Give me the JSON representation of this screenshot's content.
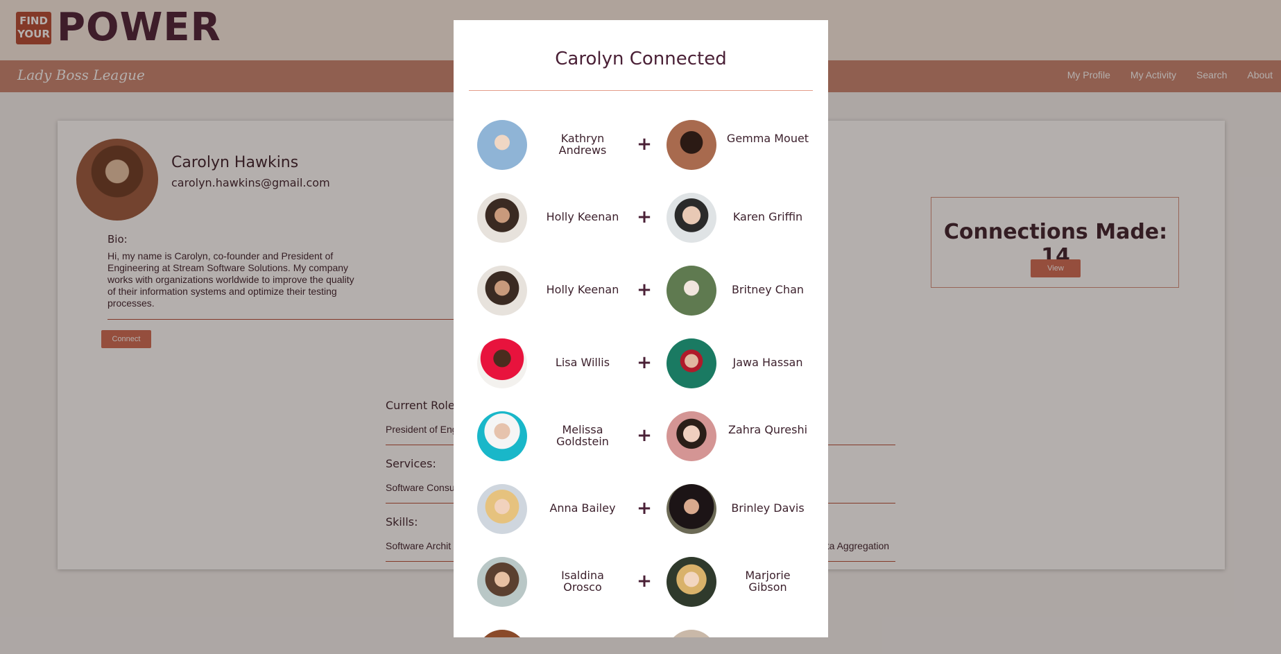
{
  "header": {
    "logo_small": "FIND YOUR",
    "logo_word": "POWER",
    "brand": "Lady Boss League",
    "nav": [
      "My Profile",
      "My Activity",
      "Search",
      "About"
    ]
  },
  "profile": {
    "name": "Carolyn Hawkins",
    "email": "carolyn.hawkins@gmail.com",
    "bio_label": "Bio:",
    "bio": "Hi, my name is Carolyn, co-founder and President of Engineering at Stream Software Solutions. My company works with organizations worldwide to improve the quality of their information systems and optimize their testing processes.",
    "connect_label": "Connect"
  },
  "connections": {
    "title": "Connections Made: 14",
    "view_label": "View"
  },
  "sections": {
    "roles_label": "Current Roles",
    "roles_value": "President of Eng",
    "services_label": "Services:",
    "services_value": "Software Consu",
    "skills_label": "Skills:",
    "skills_value": "Software Archit",
    "skills_value_right": "ata Aggregation"
  },
  "modal": {
    "title": "Carolyn Connected",
    "plus_glyph": "+",
    "pairs": [
      {
        "left": "Kathryn Andrews",
        "right": "Gemma Mouet"
      },
      {
        "left": "Holly Keenan",
        "right": "Karen Griffin"
      },
      {
        "left": "Holly Keenan",
        "right": "Britney Chan"
      },
      {
        "left": "Lisa Willis",
        "right": "Jawa Hassan"
      },
      {
        "left": "Melissa Goldstein",
        "right": "Zahra Qureshi"
      },
      {
        "left": "Anna Bailey",
        "right": "Brinley Davis"
      },
      {
        "left": "Isaldina Orosco",
        "right": "Marjorie Gibson"
      }
    ]
  },
  "colors": {
    "accent": "#c88470",
    "button": "#d06b53",
    "text": "#3b1f2b"
  }
}
